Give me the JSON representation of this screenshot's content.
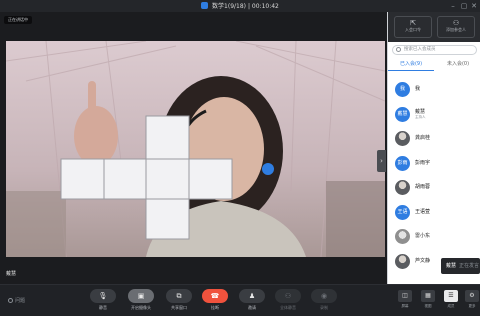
{
  "titlebar": {
    "meeting_title": "数学1(9/18)",
    "separator": "|",
    "elapsed_time": "00:10:42"
  },
  "video": {
    "speaker_tag": "正在讲话中",
    "participant_name": "戴慧"
  },
  "panel": {
    "invite_label": "入会口令",
    "add_label": "添加参会人",
    "search_placeholder": "搜索已入会成员",
    "tabs": [
      {
        "label": "已入会(9)",
        "active": true
      },
      {
        "label": "未入会(0)",
        "active": false
      }
    ],
    "participants": [
      {
        "avatar_text": "我",
        "name": "我",
        "role": "",
        "avatar_style": "blue"
      },
      {
        "avatar_text": "戴慧",
        "name": "戴慧",
        "role": "主持人",
        "avatar_style": "blue"
      },
      {
        "avatar_text": "",
        "name": "龚启桂",
        "role": "",
        "avatar_style": "photo"
      },
      {
        "avatar_text": "彭雨",
        "name": "彭雨宇",
        "role": "",
        "avatar_style": "blue"
      },
      {
        "avatar_text": "",
        "name": "胡雨蓉",
        "role": "",
        "avatar_style": "photo"
      },
      {
        "avatar_text": "王语",
        "name": "王语萱",
        "role": "",
        "avatar_style": "blue"
      },
      {
        "avatar_text": "",
        "name": "雷小东",
        "role": "",
        "avatar_style": "photo2"
      },
      {
        "avatar_text": "",
        "name": "芦文静",
        "role": "",
        "avatar_style": "photo"
      }
    ],
    "tooltip": {
      "name": "戴慧",
      "status": "正在发言"
    }
  },
  "toolbar": {
    "left_label": "问题",
    "buttons": [
      {
        "icon": "mic-icon",
        "glyph": "🎙",
        "label": "静音",
        "style": "normal"
      },
      {
        "icon": "camera-icon",
        "glyph": "▣",
        "label": "开启摄像头",
        "style": "light"
      },
      {
        "icon": "share-screen-icon",
        "glyph": "⧉",
        "label": "共享窗口",
        "style": "normal"
      },
      {
        "icon": "hangup-icon",
        "glyph": "☎",
        "label": "挂断",
        "style": "red"
      },
      {
        "icon": "invite-icon",
        "glyph": "♟",
        "label": "邀请",
        "style": "normal"
      },
      {
        "icon": "members-icon",
        "glyph": "⚇",
        "label": "全体静音",
        "style": "dim"
      },
      {
        "icon": "record-icon",
        "glyph": "◉",
        "label": "录制",
        "style": "dim"
      }
    ],
    "right_buttons": [
      {
        "icon": "screen-layout-icon",
        "glyph": "◫",
        "label": "屏幕",
        "active": false
      },
      {
        "icon": "grid-view-icon",
        "glyph": "▦",
        "label": "视图",
        "active": false
      },
      {
        "icon": "members-list-icon",
        "glyph": "☰",
        "label": "成员",
        "active": true
      },
      {
        "icon": "more-icon",
        "glyph": "⚙",
        "label": "更多",
        "active": false
      }
    ]
  }
}
